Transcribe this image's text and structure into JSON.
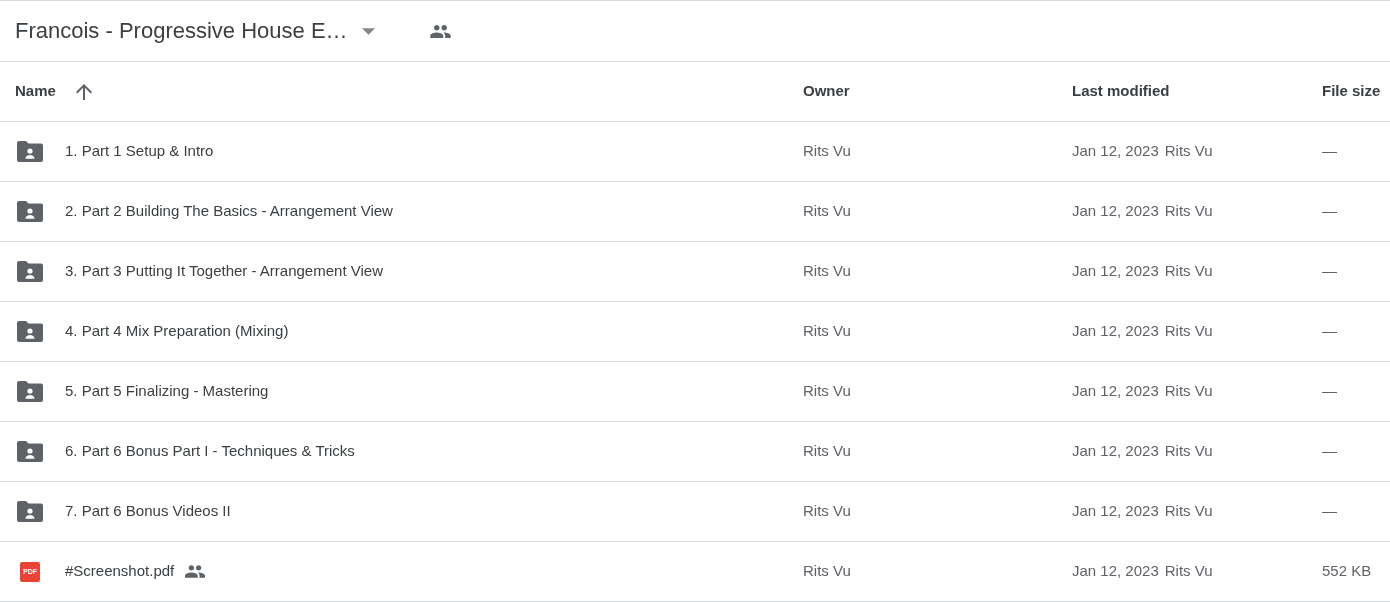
{
  "top_bar": {
    "title": "Francois - Progressive House E…",
    "shared": true
  },
  "table": {
    "columns": [
      {
        "label": "Name",
        "sorted": true
      },
      {
        "label": "Owner",
        "sorted": false
      },
      {
        "label": "Last modified",
        "sorted": false
      },
      {
        "label": "File size",
        "sorted": false
      }
    ],
    "rows": [
      {
        "kind": "folder",
        "name": "1. Part 1 Setup & Intro",
        "shared": false,
        "owner": "Rits Vu",
        "modified": "Jan 12, 2023",
        "modified_by": "Rits Vu",
        "file_size": "—"
      },
      {
        "kind": "folder",
        "name": "2. Part 2 Building The Basics - Arrangement View",
        "shared": false,
        "owner": "Rits Vu",
        "modified": "Jan 12, 2023",
        "modified_by": "Rits Vu",
        "file_size": "—"
      },
      {
        "kind": "folder",
        "name": "3. Part 3 Putting It Together - Arrangement View",
        "shared": false,
        "owner": "Rits Vu",
        "modified": "Jan 12, 2023",
        "modified_by": "Rits Vu",
        "file_size": "—"
      },
      {
        "kind": "folder",
        "name": "4. Part 4 Mix Preparation (Mixing)",
        "shared": false,
        "owner": "Rits Vu",
        "modified": "Jan 12, 2023",
        "modified_by": "Rits Vu",
        "file_size": "—"
      },
      {
        "kind": "folder",
        "name": "5. Part 5 Finalizing - Mastering",
        "shared": false,
        "owner": "Rits Vu",
        "modified": "Jan 12, 2023",
        "modified_by": "Rits Vu",
        "file_size": "—"
      },
      {
        "kind": "folder",
        "name": "6. Part 6 Bonus Part I - Techniques & Tricks",
        "shared": false,
        "owner": "Rits Vu",
        "modified": "Jan 12, 2023",
        "modified_by": "Rits Vu",
        "file_size": "—"
      },
      {
        "kind": "folder",
        "name": "7. Part 6 Bonus Videos II",
        "shared": false,
        "owner": "Rits Vu",
        "modified": "Jan 12, 2023",
        "modified_by": "Rits Vu",
        "file_size": "—"
      },
      {
        "kind": "pdf",
        "type_label": "PDF",
        "name": "#Screenshot.pdf",
        "shared": true,
        "owner": "Rits Vu",
        "modified": "Jan 12, 2023",
        "modified_by": "Rits Vu",
        "file_size": "552 KB"
      }
    ]
  }
}
